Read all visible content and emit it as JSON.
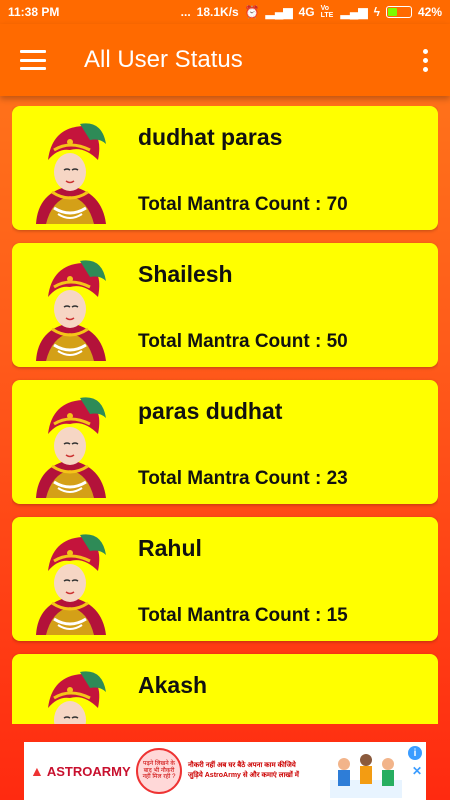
{
  "status_bar": {
    "time": "11:38 PM",
    "dots": "...",
    "speed": "18.1K/s",
    "network": "4G",
    "volte": "Vo LTE",
    "battery_percent": "42%",
    "battery_level": 0.42
  },
  "app_bar": {
    "title": "All User Status",
    "menu_icon": "hamburger-menu-icon",
    "more_icon": "more-vertical-icon"
  },
  "users": [
    {
      "name": "dudhat paras",
      "mantra_label": "Total Mantra Count : 70"
    },
    {
      "name": "Shailesh",
      "mantra_label": "Total Mantra Count : 50"
    },
    {
      "name": "paras dudhat",
      "mantra_label": "Total Mantra Count : 23"
    },
    {
      "name": "Rahul",
      "mantra_label": "Total Mantra Count : 15"
    },
    {
      "name": "Akash",
      "mantra_label": ""
    }
  ],
  "ad": {
    "brand": "ASTROARMY",
    "badge_text": "पढ़ने लिखने के बाद भी नौकरी नहीं मिल रही ?",
    "headline": "नौकरी नहीं अब घर बैठे अपना काम कीजिये",
    "subline": "जुड़िये AstroArmy से और कमाएं लाखों में",
    "info_icon": "info-icon",
    "close_icon": "close-icon"
  },
  "colors": {
    "app_bar": "#ff6a00",
    "card": "#ffff00",
    "background_top": "#ff7a1a",
    "background_bottom": "#ff2a10"
  }
}
